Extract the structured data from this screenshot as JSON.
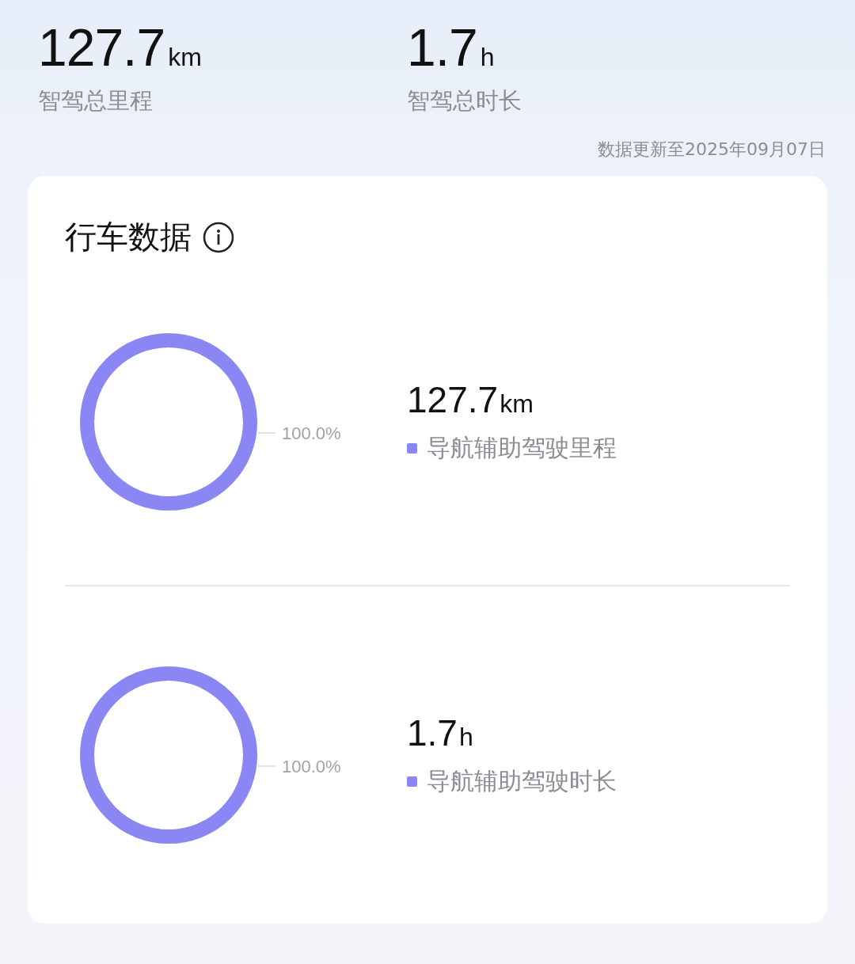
{
  "summary": [
    {
      "value": "127.7",
      "unit": "km",
      "label": "智驾总里程"
    },
    {
      "value": "1.7",
      "unit": "h",
      "label": "智驾总时长"
    }
  ],
  "updated": "数据更新至2025年09月07日",
  "card": {
    "title": "行车数据",
    "sections": [
      {
        "ring": {
          "level": 1.0,
          "label": "100.0%"
        },
        "value": "127.7",
        "unit": "km",
        "legend": {
          "label": "导航辅助驾驶里程",
          "color": "#8a86f3"
        }
      },
      {
        "ring": {
          "level": 1.0,
          "label": "100.0%"
        },
        "value": "1.7",
        "unit": "h",
        "legend": {
          "label": "导航辅助驾驶时长",
          "color": "#8a86f3"
        }
      }
    ]
  }
}
